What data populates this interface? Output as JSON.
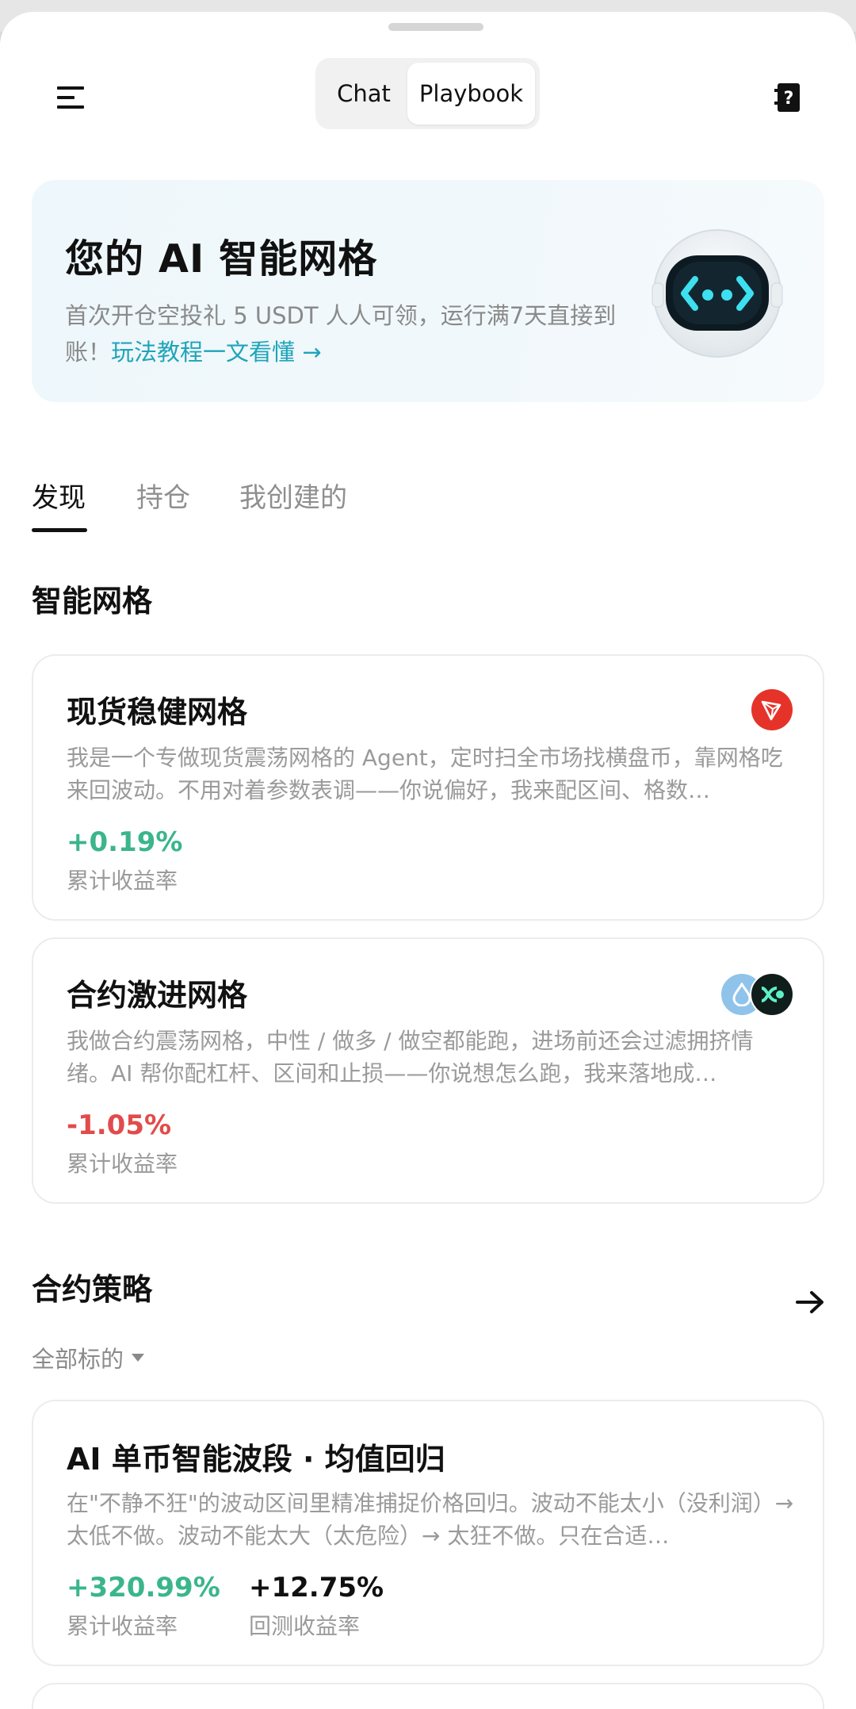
{
  "header": {
    "tabs": [
      {
        "label": "Chat"
      },
      {
        "label": "Playbook"
      }
    ]
  },
  "banner": {
    "title": "您的 AI 智能网格",
    "desc": "首次开仓空投礼 5 USDT 人人可领，运行满7天直接到账！",
    "link": "玩法教程一文看懂 →"
  },
  "tabs": [
    {
      "label": "发现"
    },
    {
      "label": "持仓"
    },
    {
      "label": "我创建的"
    }
  ],
  "grid_section": {
    "title": "智能网格",
    "cards": [
      {
        "title": "现货稳健网格",
        "desc": "我是一个专做现货震荡网格的 Agent，定时扫全市场找横盘币，靠网格吃来回波动。不用对着参数表调——你说偏好，我来配区间、格数…",
        "value": "+0.19%",
        "label": "累计收益率"
      },
      {
        "title": "合约激进网格",
        "desc": "我做合约震荡网格，中性 / 做多 / 做空都能跑，进场前还会过滤拥挤情绪。AI 帮你配杠杆、区间和止损——你说想怎么跑，我来落地成…",
        "value": "-1.05%",
        "label": "累计收益率"
      }
    ]
  },
  "strategy_section": {
    "title": "合约策略",
    "filter": "全部标的",
    "cards": [
      {
        "title": "AI 单币智能波段 · 均值回归",
        "desc": "在\"不静不狂\"的波动区间里精准捕捉价格回归。波动不能太小（没利润）→ 太低不做。波动不能太大（太危险）→ 太狂不做。只在合适…",
        "value": "+320.99%",
        "label": "累计收益率",
        "value2": "+12.75%",
        "label2": "回测收益率"
      }
    ]
  },
  "colors": {
    "positive": "#3bb58c",
    "negative": "#e24b4b",
    "link": "#1fa4b9"
  }
}
